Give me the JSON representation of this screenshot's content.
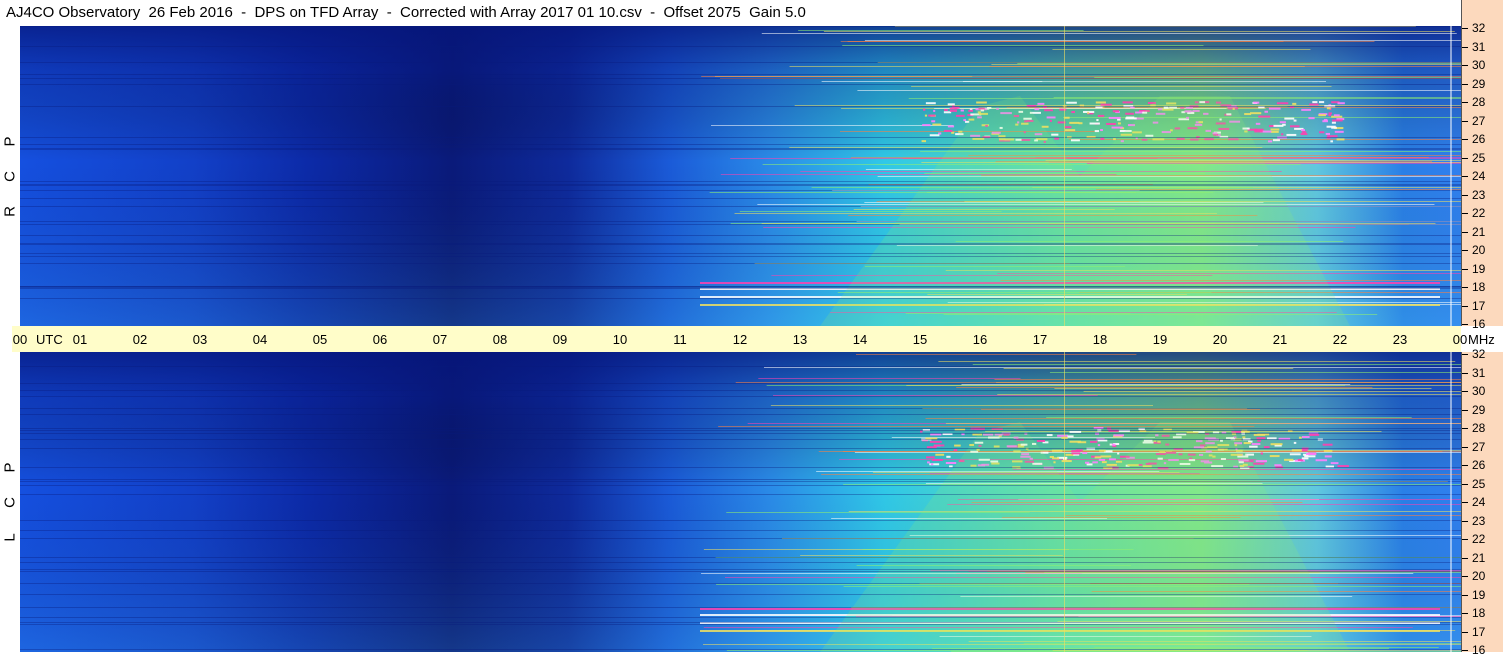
{
  "title": "AJ4CO Observatory  26 Feb 2016  -  DPS on TFD Array  -  Corrected with Array 2017 01 10.csv  -  Offset 2075  Gain 5.0",
  "panels": [
    {
      "name": "rcp",
      "letters": [
        "R",
        "C",
        "P"
      ]
    },
    {
      "name": "lcp",
      "letters": [
        "L",
        "C",
        "P"
      ]
    }
  ],
  "time_axis": {
    "labels": [
      "00",
      "01",
      "02",
      "03",
      "04",
      "05",
      "06",
      "07",
      "08",
      "09",
      "10",
      "11",
      "12",
      "13",
      "14",
      "15",
      "16",
      "17",
      "18",
      "19",
      "20",
      "21",
      "22",
      "23",
      "00"
    ],
    "first_unit": "UTC",
    "last_unit": "MHz"
  },
  "freq_axis": {
    "labels": [
      "32",
      "31",
      "30",
      "29",
      "28",
      "27",
      "26",
      "25",
      "24",
      "23",
      "22",
      "21",
      "20",
      "19",
      "18",
      "17",
      "16"
    ]
  },
  "colors": {
    "deep_blue": "#0a1a7a",
    "blue": "#1550e0",
    "cyan": "#30c8e8",
    "green": "#90f070",
    "yellow": "#f0e060",
    "magenta": "#ff3fb0",
    "white": "#ffffff",
    "axis_bg_time": "#fffdc9",
    "axis_bg_freq": "#fcd9bd"
  }
}
